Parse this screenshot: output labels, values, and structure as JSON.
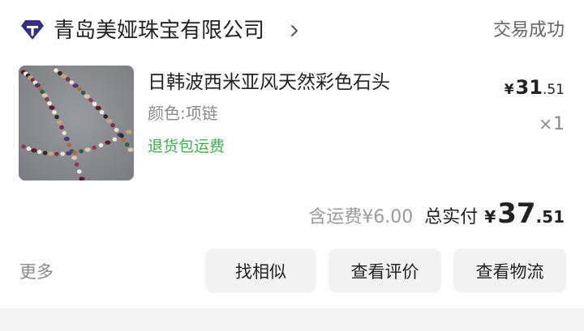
{
  "store": {
    "name": "青岛美娅珠宝有限公司",
    "logo_icon": "diamond-logo-icon",
    "chevron_icon": "chevron-right-icon"
  },
  "order": {
    "status": "交易成功"
  },
  "product": {
    "title": "日韩波西米亚风天然彩色石头",
    "spec": "颜色:项链",
    "service_tag": "退货包运费",
    "price": {
      "currency": "¥",
      "integer": "31",
      "decimal": ".51"
    },
    "quantity": {
      "symbol": "×",
      "count": "1"
    }
  },
  "totals": {
    "shipping_note": "含运费¥6.00",
    "label": "总实付",
    "currency": "¥",
    "integer": "37",
    "decimal": ".51"
  },
  "actions": {
    "more": "更多",
    "find_similar": "找相似",
    "view_review": "查看评价",
    "view_logistics": "查看物流"
  },
  "colors": {
    "logo": "#35307f",
    "service_green": "#3fae4e",
    "button_bg": "#f3f3f3",
    "muted_text": "#8a8a8a"
  }
}
